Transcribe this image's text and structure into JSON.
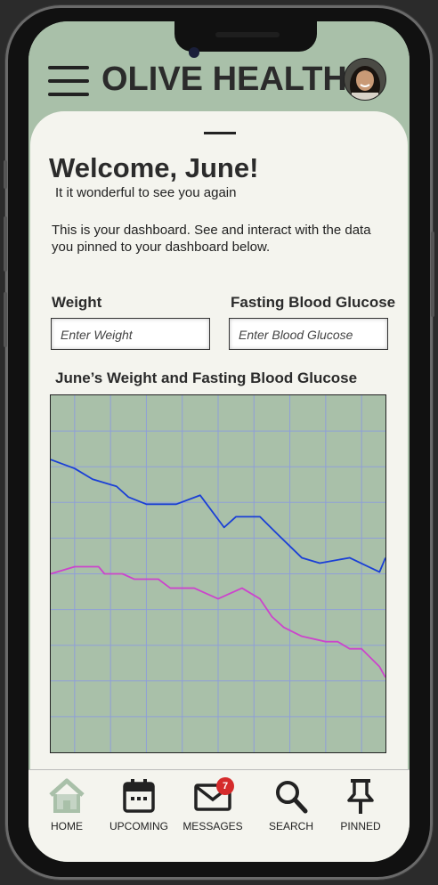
{
  "app": {
    "brand": "OLIVE HEALTH"
  },
  "dashboard": {
    "welcome": "Welcome, June!",
    "subtitle": "It it wonderful to see you again",
    "description": "This is your dashboard. See and interact with the data you pinned to your dashboard below."
  },
  "inputs": {
    "weight_label": "Weight",
    "weight_placeholder": "Enter Weight",
    "glucose_label": "Fasting Blood Glucose",
    "glucose_placeholder": "Enter Blood Glucose"
  },
  "chart_title": "June’s Weight and Fasting Blood Glucose",
  "chart_data": {
    "type": "line",
    "title": "June’s Weight and Fasting Blood Glucose",
    "xlabel": "",
    "ylabel": "",
    "grid": true,
    "xlim": [
      0,
      28
    ],
    "ylim": [
      0,
      20
    ],
    "series": [
      {
        "color": "#1a3fd6",
        "x": [
          0,
          2,
          3.5,
          5.5,
          6.5,
          8,
          10.5,
          12.5,
          14.5,
          15.5,
          17.5,
          19,
          21,
          22.5,
          25,
          27.5,
          28
        ],
        "y": [
          16.4,
          15.9,
          15.3,
          14.9,
          14.3,
          13.9,
          13.9,
          14.4,
          12.6,
          13.2,
          13.2,
          12.2,
          10.9,
          10.6,
          10.9,
          10.1,
          10.9
        ]
      },
      {
        "color": "#cc44cc",
        "x": [
          0,
          2,
          4,
          4.5,
          6,
          7,
          9,
          10,
          12,
          14,
          16,
          17.5,
          18.5,
          19.5,
          21,
          23,
          24,
          25,
          26,
          27.5,
          28
        ],
        "y": [
          10.0,
          10.4,
          10.4,
          10.0,
          10.0,
          9.7,
          9.7,
          9.2,
          9.2,
          8.6,
          9.2,
          8.6,
          7.6,
          7.0,
          6.5,
          6.2,
          6.2,
          5.8,
          5.8,
          4.8,
          4.2
        ]
      }
    ]
  },
  "nav": {
    "home": "HOME",
    "upcoming": "UPCOMING",
    "messages": "MESSAGES",
    "messages_badge": "7",
    "search": "SEARCH",
    "pinned": "PINNED"
  },
  "icons": [
    "menu-icon",
    "home-icon",
    "calendar-icon",
    "mail-icon",
    "search-icon",
    "pin-icon"
  ],
  "colors": {
    "accent": "#a9c0a9",
    "card": "#f4f4ee",
    "badge": "#d52b2b"
  }
}
